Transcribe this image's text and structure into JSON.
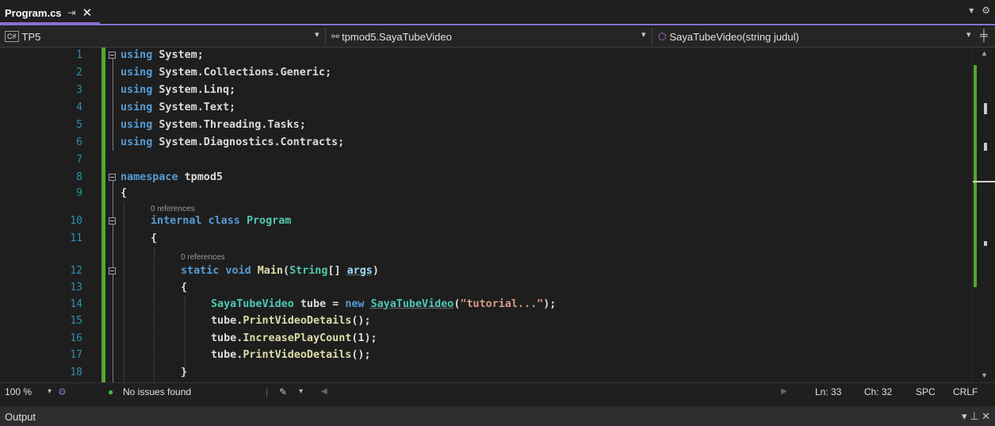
{
  "tab": {
    "title": "Program.cs",
    "pin": "⇥",
    "close": "✕"
  },
  "window_controls": {
    "dropdown": "▾",
    "settings": "⚙"
  },
  "navbar": {
    "project_badge": "C#",
    "project": "TP5",
    "type": "tpmod5.SayaTubeVideo",
    "member": "SayaTubeVideo(string judul)",
    "split": "╪"
  },
  "editor": {
    "line_numbers": [
      "1",
      "2",
      "3",
      "4",
      "5",
      "6",
      "7",
      "8",
      "9",
      "10",
      "11",
      "12",
      "13",
      "14",
      "15",
      "16",
      "17",
      "18"
    ],
    "references": [
      "0 references",
      "0 references"
    ],
    "code": {
      "l1": [
        "using",
        " System;"
      ],
      "l2": [
        "using",
        " System.Collections.Generic;"
      ],
      "l3": [
        "using",
        " System.Linq;"
      ],
      "l4": [
        "using",
        " System.Text;"
      ],
      "l5": [
        "using",
        " System.Threading.Tasks;"
      ],
      "l6": [
        "using",
        " System.Diagnostics.Contracts;"
      ],
      "l8": [
        "namespace",
        " tpmod5"
      ],
      "l9": "{",
      "l10": [
        "internal",
        " class ",
        "Program"
      ],
      "l11": "{",
      "l12": [
        "static",
        " void ",
        "Main",
        "(",
        "String",
        "[] ",
        "args",
        ")"
      ],
      "l13": "{",
      "l14": [
        "SayaTubeVideo",
        " tube = ",
        "new",
        " ",
        "SayaTubeVideo",
        "(",
        "\"tutorial...\"",
        ");"
      ],
      "l15": [
        "tube",
        ".",
        "PrintVideoDetails",
        "();"
      ],
      "l16": [
        "tube",
        ".",
        "IncreasePlayCount",
        "(1);"
      ],
      "l17": [
        "tube",
        ".",
        "PrintVideoDetails",
        "();"
      ],
      "l18": "}"
    }
  },
  "statusbar": {
    "zoom": "100 %",
    "issues": "No issues found",
    "ln": "Ln: 33",
    "ch": "Ch: 32",
    "spc": "SPC",
    "eol": "CRLF"
  },
  "output": {
    "title": "Output",
    "controls": "▾ ⊥ ✕"
  },
  "colors": {
    "accent": "#8a6fd1",
    "keyword": "#569cd6",
    "class": "#4ec9b0",
    "method": "#dcdcaa",
    "string": "#d69d85",
    "line_number": "#2b91af",
    "change_bar": "#55a630"
  }
}
